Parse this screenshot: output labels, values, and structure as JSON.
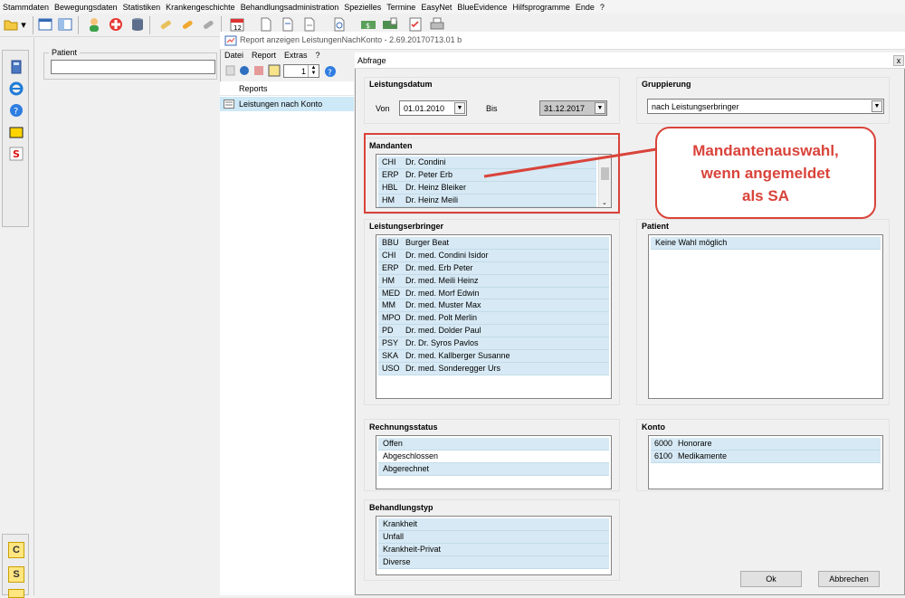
{
  "main_menu": [
    "Stammdaten",
    "Bewegungsdaten",
    "Statistiken",
    "Krankengeschichte",
    "Behandlungsadministration",
    "Spezielles",
    "Termine",
    "EasyNet",
    "BlueEvidence",
    "Hilfsprogramme",
    "Ende",
    "?"
  ],
  "patient": {
    "label": "Patient",
    "value": ""
  },
  "left_buttons": [
    "C",
    "S"
  ],
  "report_window": {
    "title": "Report anzeigen LeistungenNachKonto - 2.69.20170713.01 b",
    "menu": [
      "Datei",
      "Report",
      "Extras",
      "?"
    ],
    "spin_value": "1",
    "reports_header": "Reports",
    "reports": [
      "Leistungen nach Konto"
    ]
  },
  "abfrage": {
    "title": "Abfrage",
    "close": "x",
    "leistungsdatum": {
      "title": "Leistungsdatum",
      "von_label": "Von",
      "von": "01.01.2010",
      "bis_label": "Bis",
      "bis": "31.12.2017"
    },
    "gruppierung": {
      "title": "Gruppierung",
      "value": "nach Leistungserbringer"
    },
    "mandanten": {
      "title": "Mandanten",
      "rows": [
        [
          "CHI",
          "Dr. Condini"
        ],
        [
          "ERP",
          "Dr. Peter Erb"
        ],
        [
          "HBL",
          "Dr. Heinz Bleiker"
        ],
        [
          "HM",
          "Dr. Heinz Meili"
        ]
      ]
    },
    "leistungserbringer": {
      "title": "Leistungserbringer",
      "rows": [
        [
          "BBU",
          "Burger Beat"
        ],
        [
          "CHI",
          "Dr. med. Condini Isidor"
        ],
        [
          "ERP",
          "Dr. med. Erb Peter"
        ],
        [
          "HM",
          "Dr. med. Meili Heinz"
        ],
        [
          "MED",
          "Dr. med. Morf Edwin"
        ],
        [
          "MM",
          "Dr. med. Muster Max"
        ],
        [
          "MPO",
          "Dr. med. Polt Merlin"
        ],
        [
          "PD",
          "Dr. med. Dolder Paul"
        ],
        [
          "PSY",
          "Dr. Dr. Syros Pavlos"
        ],
        [
          "SKA",
          "Dr. med. Kallberger Susanne"
        ],
        [
          "USO",
          "Dr. med. Sonderegger Urs"
        ]
      ]
    },
    "patient": {
      "title": "Patient",
      "rows": [
        "Keine Wahl möglich"
      ]
    },
    "rechnungsstatus": {
      "title": "Rechnungsstatus",
      "rows": [
        "Offen",
        "Abgeschlossen",
        "Abgerechnet"
      ]
    },
    "konto": {
      "title": "Konto",
      "rows": [
        [
          "6000",
          "Honorare"
        ],
        [
          "6100",
          "Medikamente"
        ]
      ]
    },
    "behandlungstyp": {
      "title": "Behandlungstyp",
      "rows": [
        "Krankheit",
        "Unfall",
        "Krankheit-Privat",
        "Diverse"
      ]
    },
    "ok": "Ok",
    "abbrechen": "Abbrechen"
  },
  "callout": {
    "lines": [
      "Mandantenauswahl,",
      "wenn angemeldet",
      "als SA"
    ],
    "color": "#d9433a"
  }
}
